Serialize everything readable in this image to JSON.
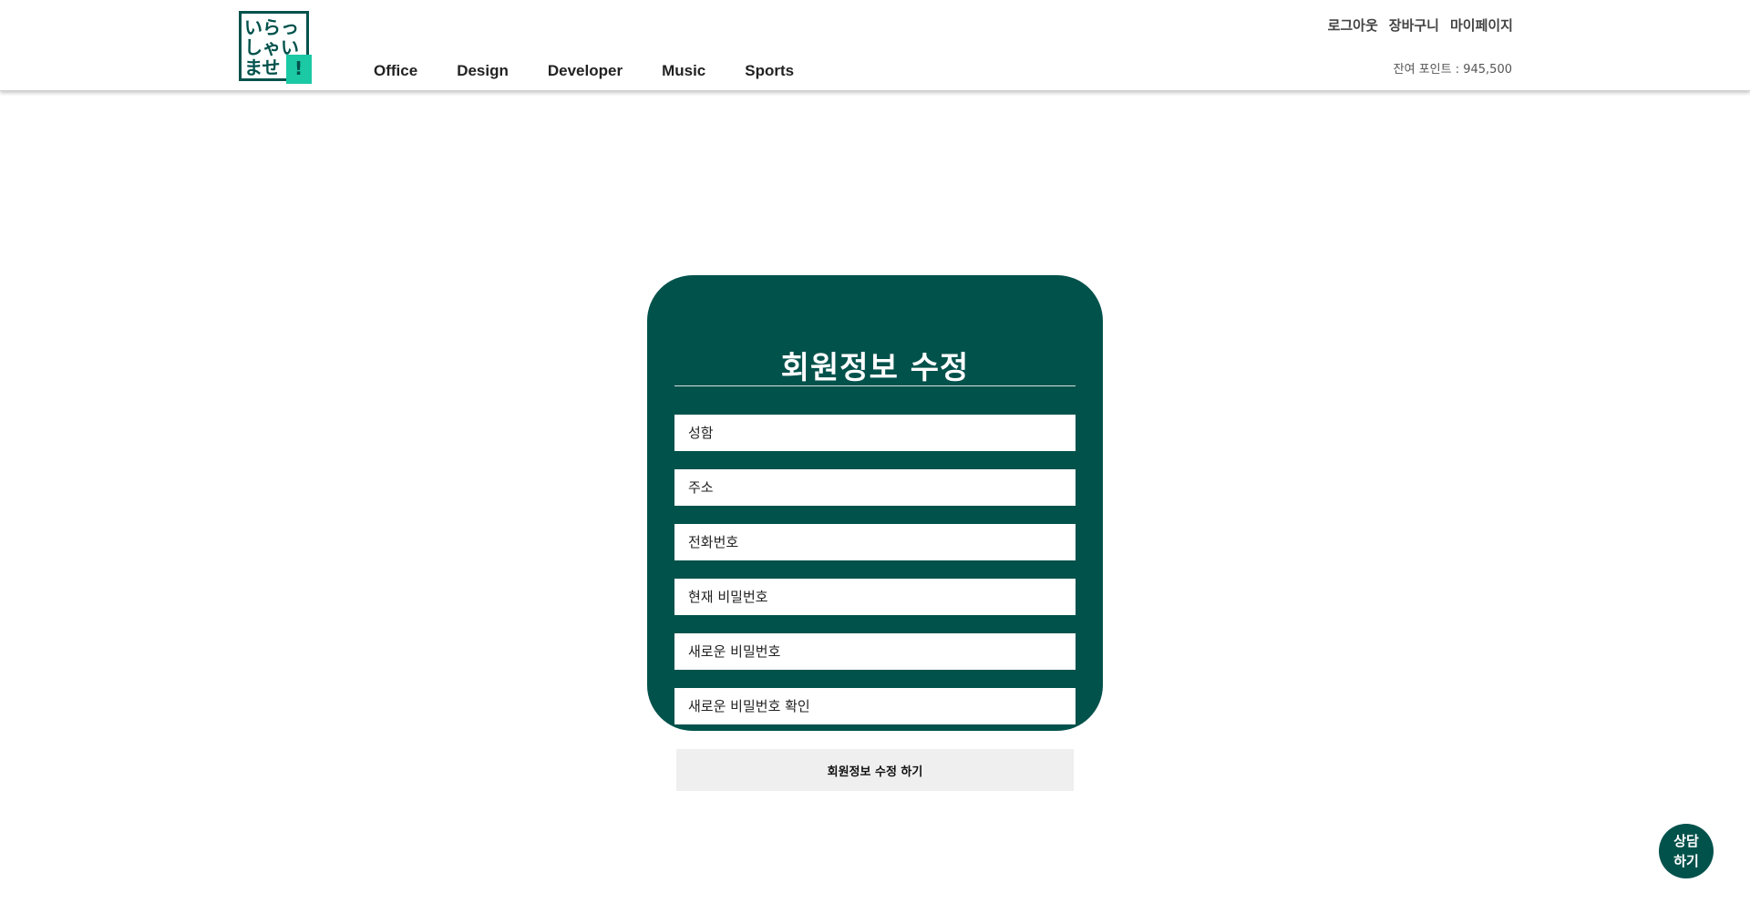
{
  "logo": {
    "line1": "いらっ",
    "line2": "しゃい",
    "line3": "ませ",
    "accent_mark": "!",
    "colors": {
      "frame": "#02524c",
      "accent": "#1bc9a5"
    }
  },
  "nav": {
    "items": [
      {
        "label": "Office"
      },
      {
        "label": "Design"
      },
      {
        "label": "Developer"
      },
      {
        "label": "Music"
      },
      {
        "label": "Sports"
      }
    ]
  },
  "top_links": {
    "logout": "로그아웃",
    "cart": "장바구니",
    "mypage": "마이페이지"
  },
  "points": {
    "text": "잔여 포인트 : 945,500"
  },
  "form": {
    "title": "회원정보 수정",
    "fields": [
      {
        "placeholder": "성함"
      },
      {
        "placeholder": "주소"
      },
      {
        "placeholder": "전화번호"
      },
      {
        "placeholder": "현재 비밀번호"
      },
      {
        "placeholder": "새로운 비밀번호"
      },
      {
        "placeholder": "새로운 비밀번호 확인"
      }
    ],
    "submit_label": "회원정보 수정 하기"
  },
  "chat": {
    "line1": "상담",
    "line2": "하기"
  },
  "colors": {
    "brand": "#02524c",
    "accent": "#1bc9a5",
    "button_bg": "#efefef"
  }
}
